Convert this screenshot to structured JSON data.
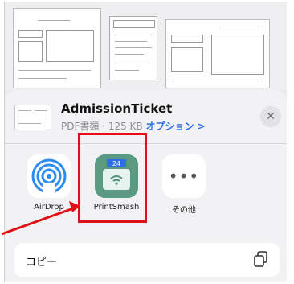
{
  "document_title": "AdmissionTicket",
  "document_info": "PDF書類 · 125 KB",
  "options_label": "オプション >",
  "close_label": "✕",
  "apps": [
    {
      "label": "AirDrop",
      "icon": "airdrop-icon"
    },
    {
      "label": "PrintSmash",
      "icon": "printsmash-icon",
      "badge": "24"
    },
    {
      "label": "その他",
      "icon": "more-icon",
      "glyph": "•••"
    }
  ],
  "actions": [
    {
      "label": "コピー",
      "icon": "copy-icon"
    }
  ],
  "annotation": {
    "highlight_color": "#e01016",
    "arrow_color": "#e01016"
  }
}
